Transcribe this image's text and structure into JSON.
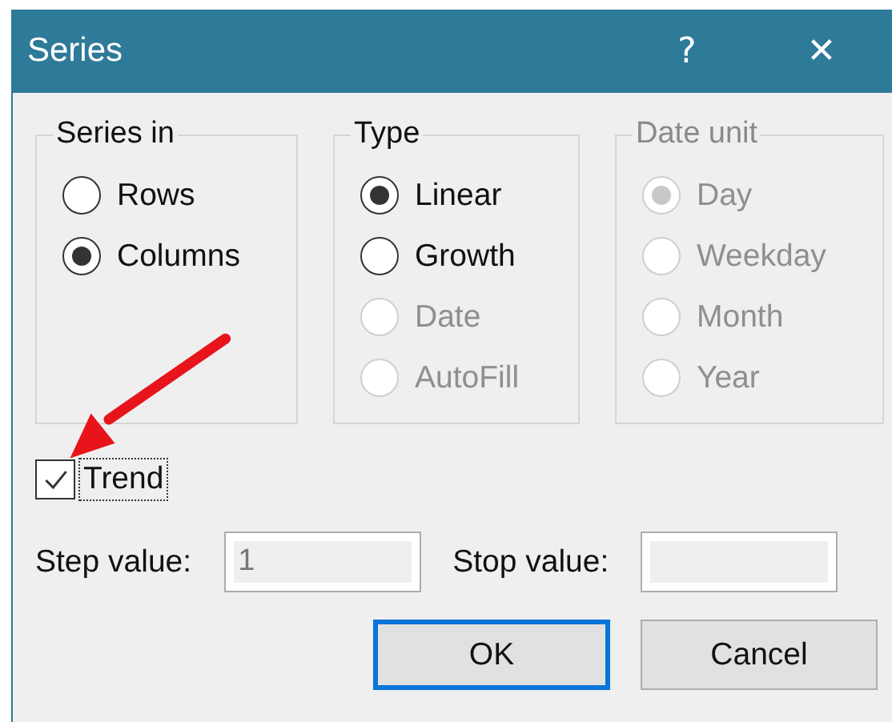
{
  "window": {
    "title": "Series",
    "help": "?",
    "close": "✕"
  },
  "groups": [
    {
      "title": "Series in",
      "disabled": false,
      "options": [
        {
          "label": "Rows",
          "selected": false,
          "disabled": false
        },
        {
          "label": "Columns",
          "selected": true,
          "disabled": false
        }
      ]
    },
    {
      "title": "Type",
      "disabled": false,
      "options": [
        {
          "label": "Linear",
          "selected": true,
          "disabled": false
        },
        {
          "label": "Growth",
          "selected": false,
          "disabled": false
        },
        {
          "label": "Date",
          "selected": false,
          "disabled": true
        },
        {
          "label": "AutoFill",
          "selected": false,
          "disabled": true
        }
      ]
    },
    {
      "title": "Date unit",
      "disabled": true,
      "options": [
        {
          "label": "Day",
          "selected": true,
          "disabled": true
        },
        {
          "label": "Weekday",
          "selected": false,
          "disabled": true
        },
        {
          "label": "Month",
          "selected": false,
          "disabled": true
        },
        {
          "label": "Year",
          "selected": false,
          "disabled": true
        }
      ]
    }
  ],
  "trend": {
    "label": "Trend",
    "checked": true,
    "focused": true
  },
  "fields": [
    {
      "label": "Step value:",
      "value": "1",
      "disabled": true
    },
    {
      "label": "Stop value:",
      "disabled": true
    }
  ],
  "buttons": [
    {
      "label": "OK",
      "default": true
    },
    {
      "label": "Cancel",
      "default": false
    }
  ]
}
